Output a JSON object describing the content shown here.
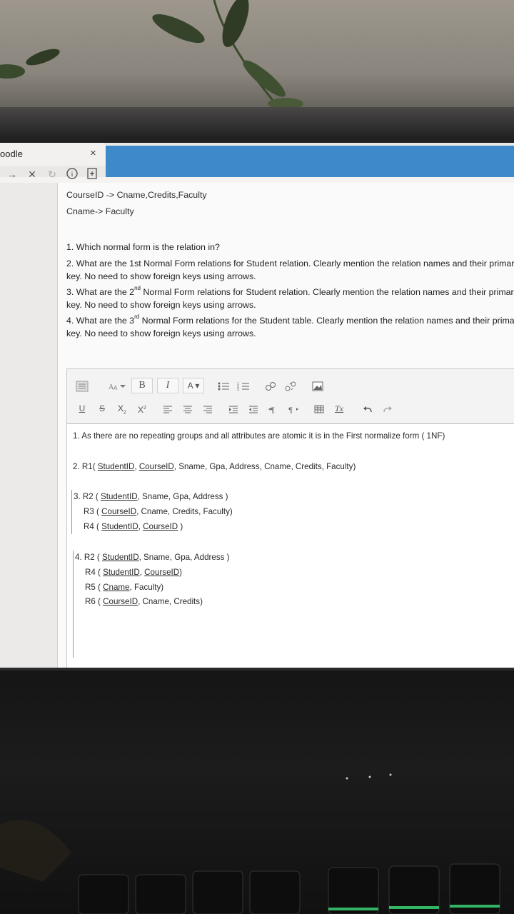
{
  "browser": {
    "tab_title": "oodle",
    "tab_close": "×",
    "nav": {
      "forward": "→",
      "stop": "✕",
      "reload": "↻",
      "info": "i"
    }
  },
  "question": {
    "fd_lines": [
      "CourseID -> Cname,Credits,Faculty",
      "Cname-> Faculty"
    ],
    "items": [
      {
        "number": "1",
        "text": "Which normal form is the relation in?"
      },
      {
        "number": "2",
        "text": "What are the  1st Normal Form relations for Student relation. Clearly mention the relation names and their primary key. No need to show foreign keys using arrows."
      },
      {
        "number": "3",
        "prefix": "What are the 2",
        "sup": "nd",
        "text": " Normal Form relations for Student relation. Clearly mention the relation names and their primary key. No need to show foreign keys using arrows."
      },
      {
        "number": "4",
        "prefix": "What are the 3",
        "sup": "rd",
        "text": " Normal Form relations for the Student table. Clearly mention the relation names and their primary key. No need to show foreign keys using arrows."
      }
    ]
  },
  "toolbar": {
    "row1": [
      "paragraph-icon",
      "font-size-icon",
      "B",
      "I",
      "A",
      "bullet-list-icon",
      "numbered-list-icon",
      "link-icon",
      "unlink-icon",
      "image-icon"
    ],
    "row2": [
      "U",
      "S",
      "X₂",
      "X²",
      "align-left-icon",
      "align-center-icon",
      "align-right-icon",
      "indent-icon",
      "outdent-icon",
      "ltr-icon",
      "rtl-icon",
      "table-icon",
      "clear-format-icon",
      "undo-icon",
      "redo-icon"
    ],
    "bold": "B",
    "italic": "I",
    "color": "A",
    "underline": "U",
    "strike": "S",
    "sub": "X",
    "sup": "X",
    "sub_mark": "2",
    "sup_mark": "2",
    "clear": "Tx"
  },
  "answer": {
    "a1": "1. As there are no repeating groups and all attributes are atomic it is in the First normalize form ( 1NF)",
    "a2": {
      "pre": "2. R1( ",
      "k1": "StudentID",
      "sep": ", ",
      "k2": "CourseID",
      "post": ", Sname, Gpa, Address, Cname, Credits, Faculty)"
    },
    "a3": [
      {
        "pre": "3. R2 ( ",
        "k1": "StudentID",
        "post": ", Sname, Gpa, Address )"
      },
      {
        "pre": "R3 ( ",
        "k1": "CourseID",
        "post": ", Cname, Credits, Faculty)"
      },
      {
        "pre": "R4 ( ",
        "k1": "StudentID",
        "sep": ", ",
        "k2": "CourseID",
        "post": " )"
      }
    ],
    "a4": [
      {
        "pre": "4. R2 ( ",
        "k1": "StudentID",
        "post": ", Sname, Gpa, Address )"
      },
      {
        "pre": "R4 ( ",
        "k1": "StudentID",
        "sep": ", ",
        "k2": "CourseID",
        "post": ")"
      },
      {
        "pre": "R5 ( ",
        "k1": "Cname",
        "post": ", Faculty)"
      },
      {
        "pre": "R6 ( ",
        "k1": "CourseID",
        "post": ", Cname, Credits)"
      }
    ]
  },
  "colors": {
    "accent_blue": "#3d89c9",
    "accent_orange": "#e6761f",
    "key_glow": "#3be07a"
  }
}
